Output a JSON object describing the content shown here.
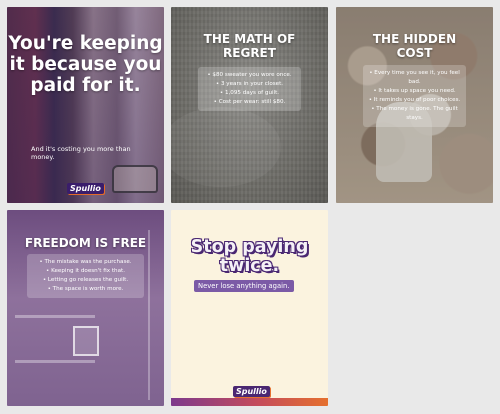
{
  "brand": {
    "logo_text": "Spullio",
    "accent": "#e5702e",
    "primary": "#4a2772"
  },
  "cards": [
    {
      "title": "You're keeping it because you paid for it.",
      "subtitle": "And it's costing you more than money."
    },
    {
      "title": "THE MATH OF REGRET",
      "items": [
        "• $80 sweater you wore once.",
        "• 3 years in your closet.",
        "• 1,095 days of guilt.",
        "• Cost per wear: still $80."
      ]
    },
    {
      "title": "THE HIDDEN COST",
      "items": [
        "• Every time you see it, you feel",
        "bad.",
        "• It takes up space you need.",
        "• It reminds you of poor choices.",
        "• The money is gone. The guilt",
        "stays."
      ]
    },
    {
      "title": "FREEDOM IS FREE",
      "items": [
        "• The mistake was the purchase.",
        "• Keeping it doesn't fix that.",
        "• Letting go releases the guilt.",
        "• The space is worth more."
      ]
    },
    {
      "title": "Stop paying twice.",
      "tagline": "Never lose anything again."
    }
  ]
}
